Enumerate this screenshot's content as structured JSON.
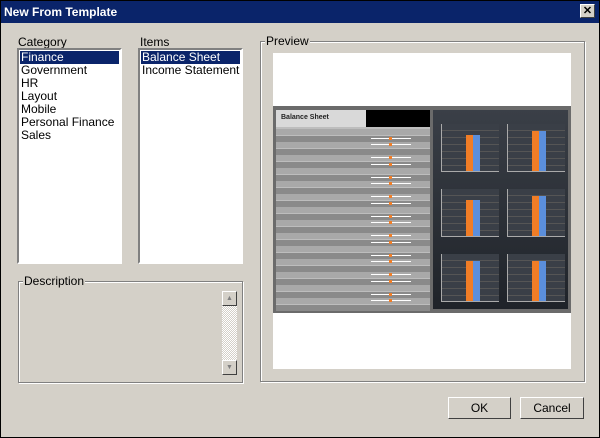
{
  "window": {
    "title": "New From Template",
    "close_icon": "close-icon"
  },
  "category": {
    "label": "Category",
    "items": [
      "Finance",
      "Government",
      "HR",
      "Layout",
      "Mobile",
      "Personal Finance",
      "Sales"
    ],
    "selected": 0
  },
  "items": {
    "label": "Items",
    "items": [
      "Balance Sheet",
      "Income Statement"
    ],
    "selected": 0
  },
  "preview": {
    "label": "Preview",
    "thumb_title": "Balance Sheet",
    "colors": {
      "orange": "#f07d26",
      "blue": "#5b8fdc"
    }
  },
  "description": {
    "label": "Description",
    "text": ""
  },
  "buttons": {
    "ok": "OK",
    "cancel": "Cancel"
  }
}
